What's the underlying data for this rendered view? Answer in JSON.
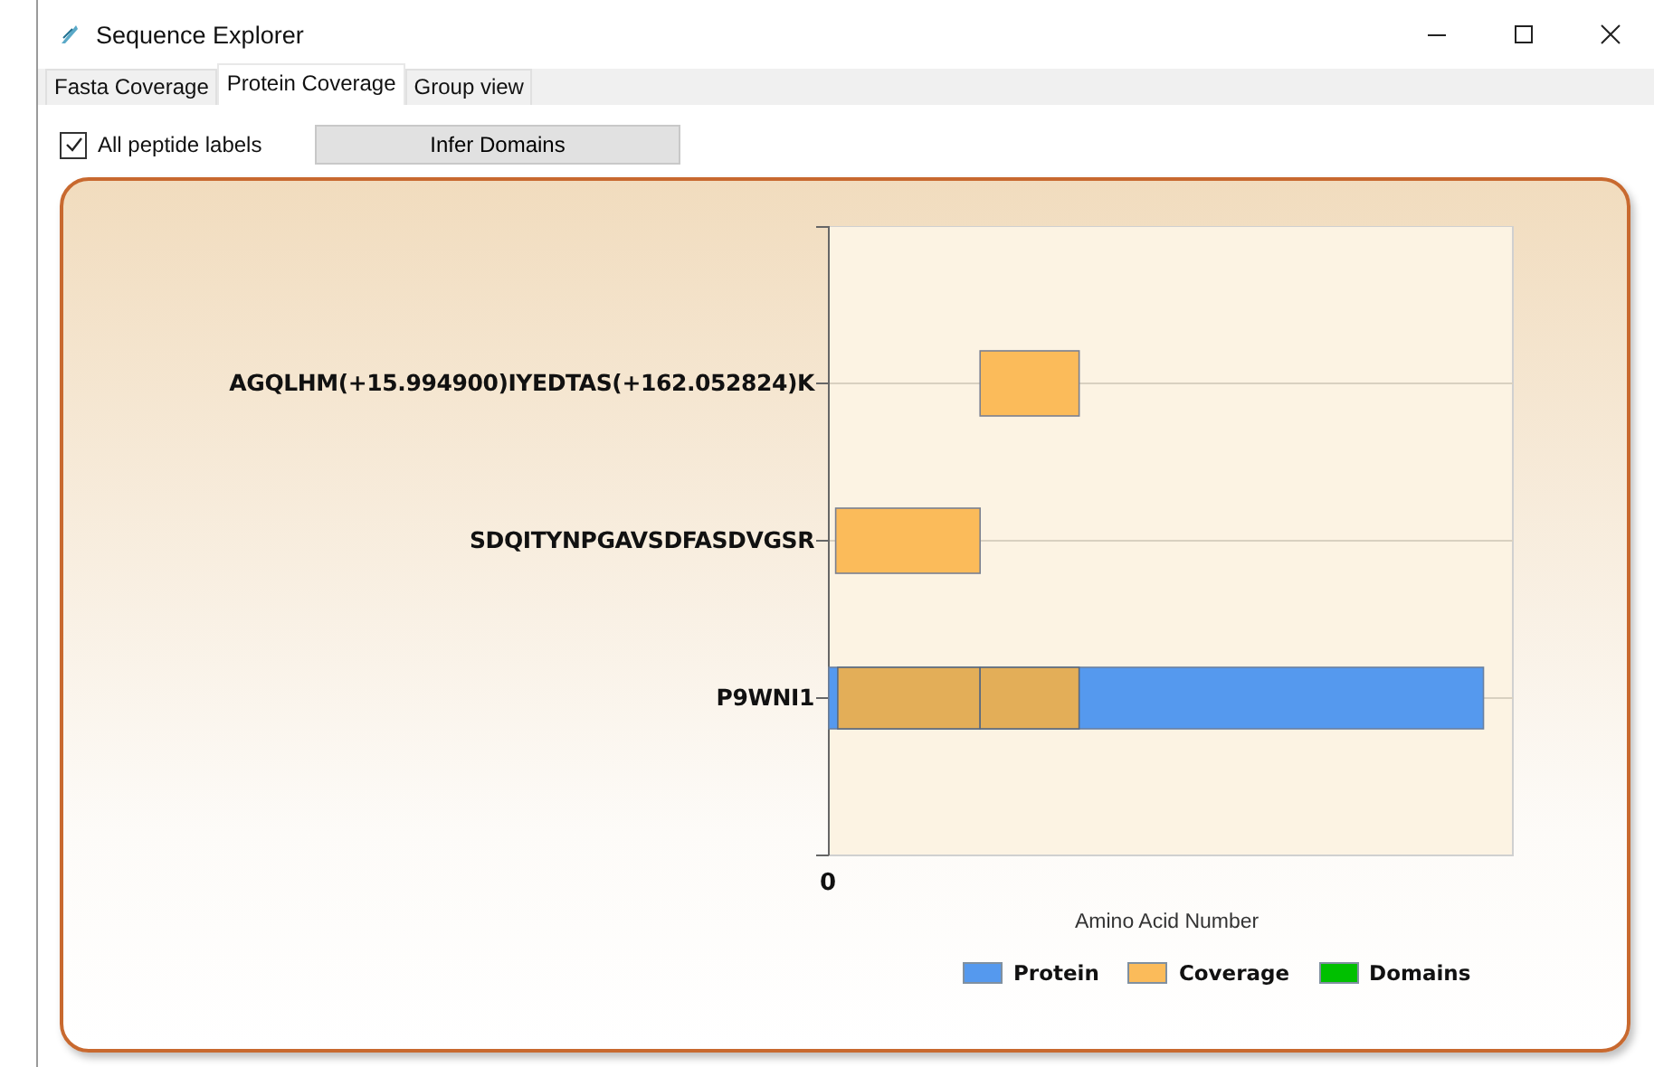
{
  "window": {
    "title": "Sequence Explorer"
  },
  "tabs": [
    {
      "label": "Fasta Coverage",
      "selected": false
    },
    {
      "label": "Protein Coverage",
      "selected": true
    },
    {
      "label": "Group view",
      "selected": false
    }
  ],
  "toolbar": {
    "checkbox": {
      "label": "All peptide labels",
      "checked": true
    },
    "button": "Infer Domains"
  },
  "chart": {
    "rows": [
      {
        "label": "AGQLHM(+15.994900)IYEDTAS(+162.052824)K",
        "kind": "peptide"
      },
      {
        "label": "SDQITYNPGAVSDFASDVGSR",
        "kind": "peptide"
      },
      {
        "label": "P9WNI1",
        "kind": "protein"
      }
    ],
    "x_tick": "0",
    "xlabel": "Amino Acid Number",
    "legend": [
      {
        "label": "Protein",
        "color": "#5599ee"
      },
      {
        "label": "Coverage",
        "color": "#fbbb5a"
      },
      {
        "label": "Domains",
        "color": "#00c000"
      }
    ]
  }
}
